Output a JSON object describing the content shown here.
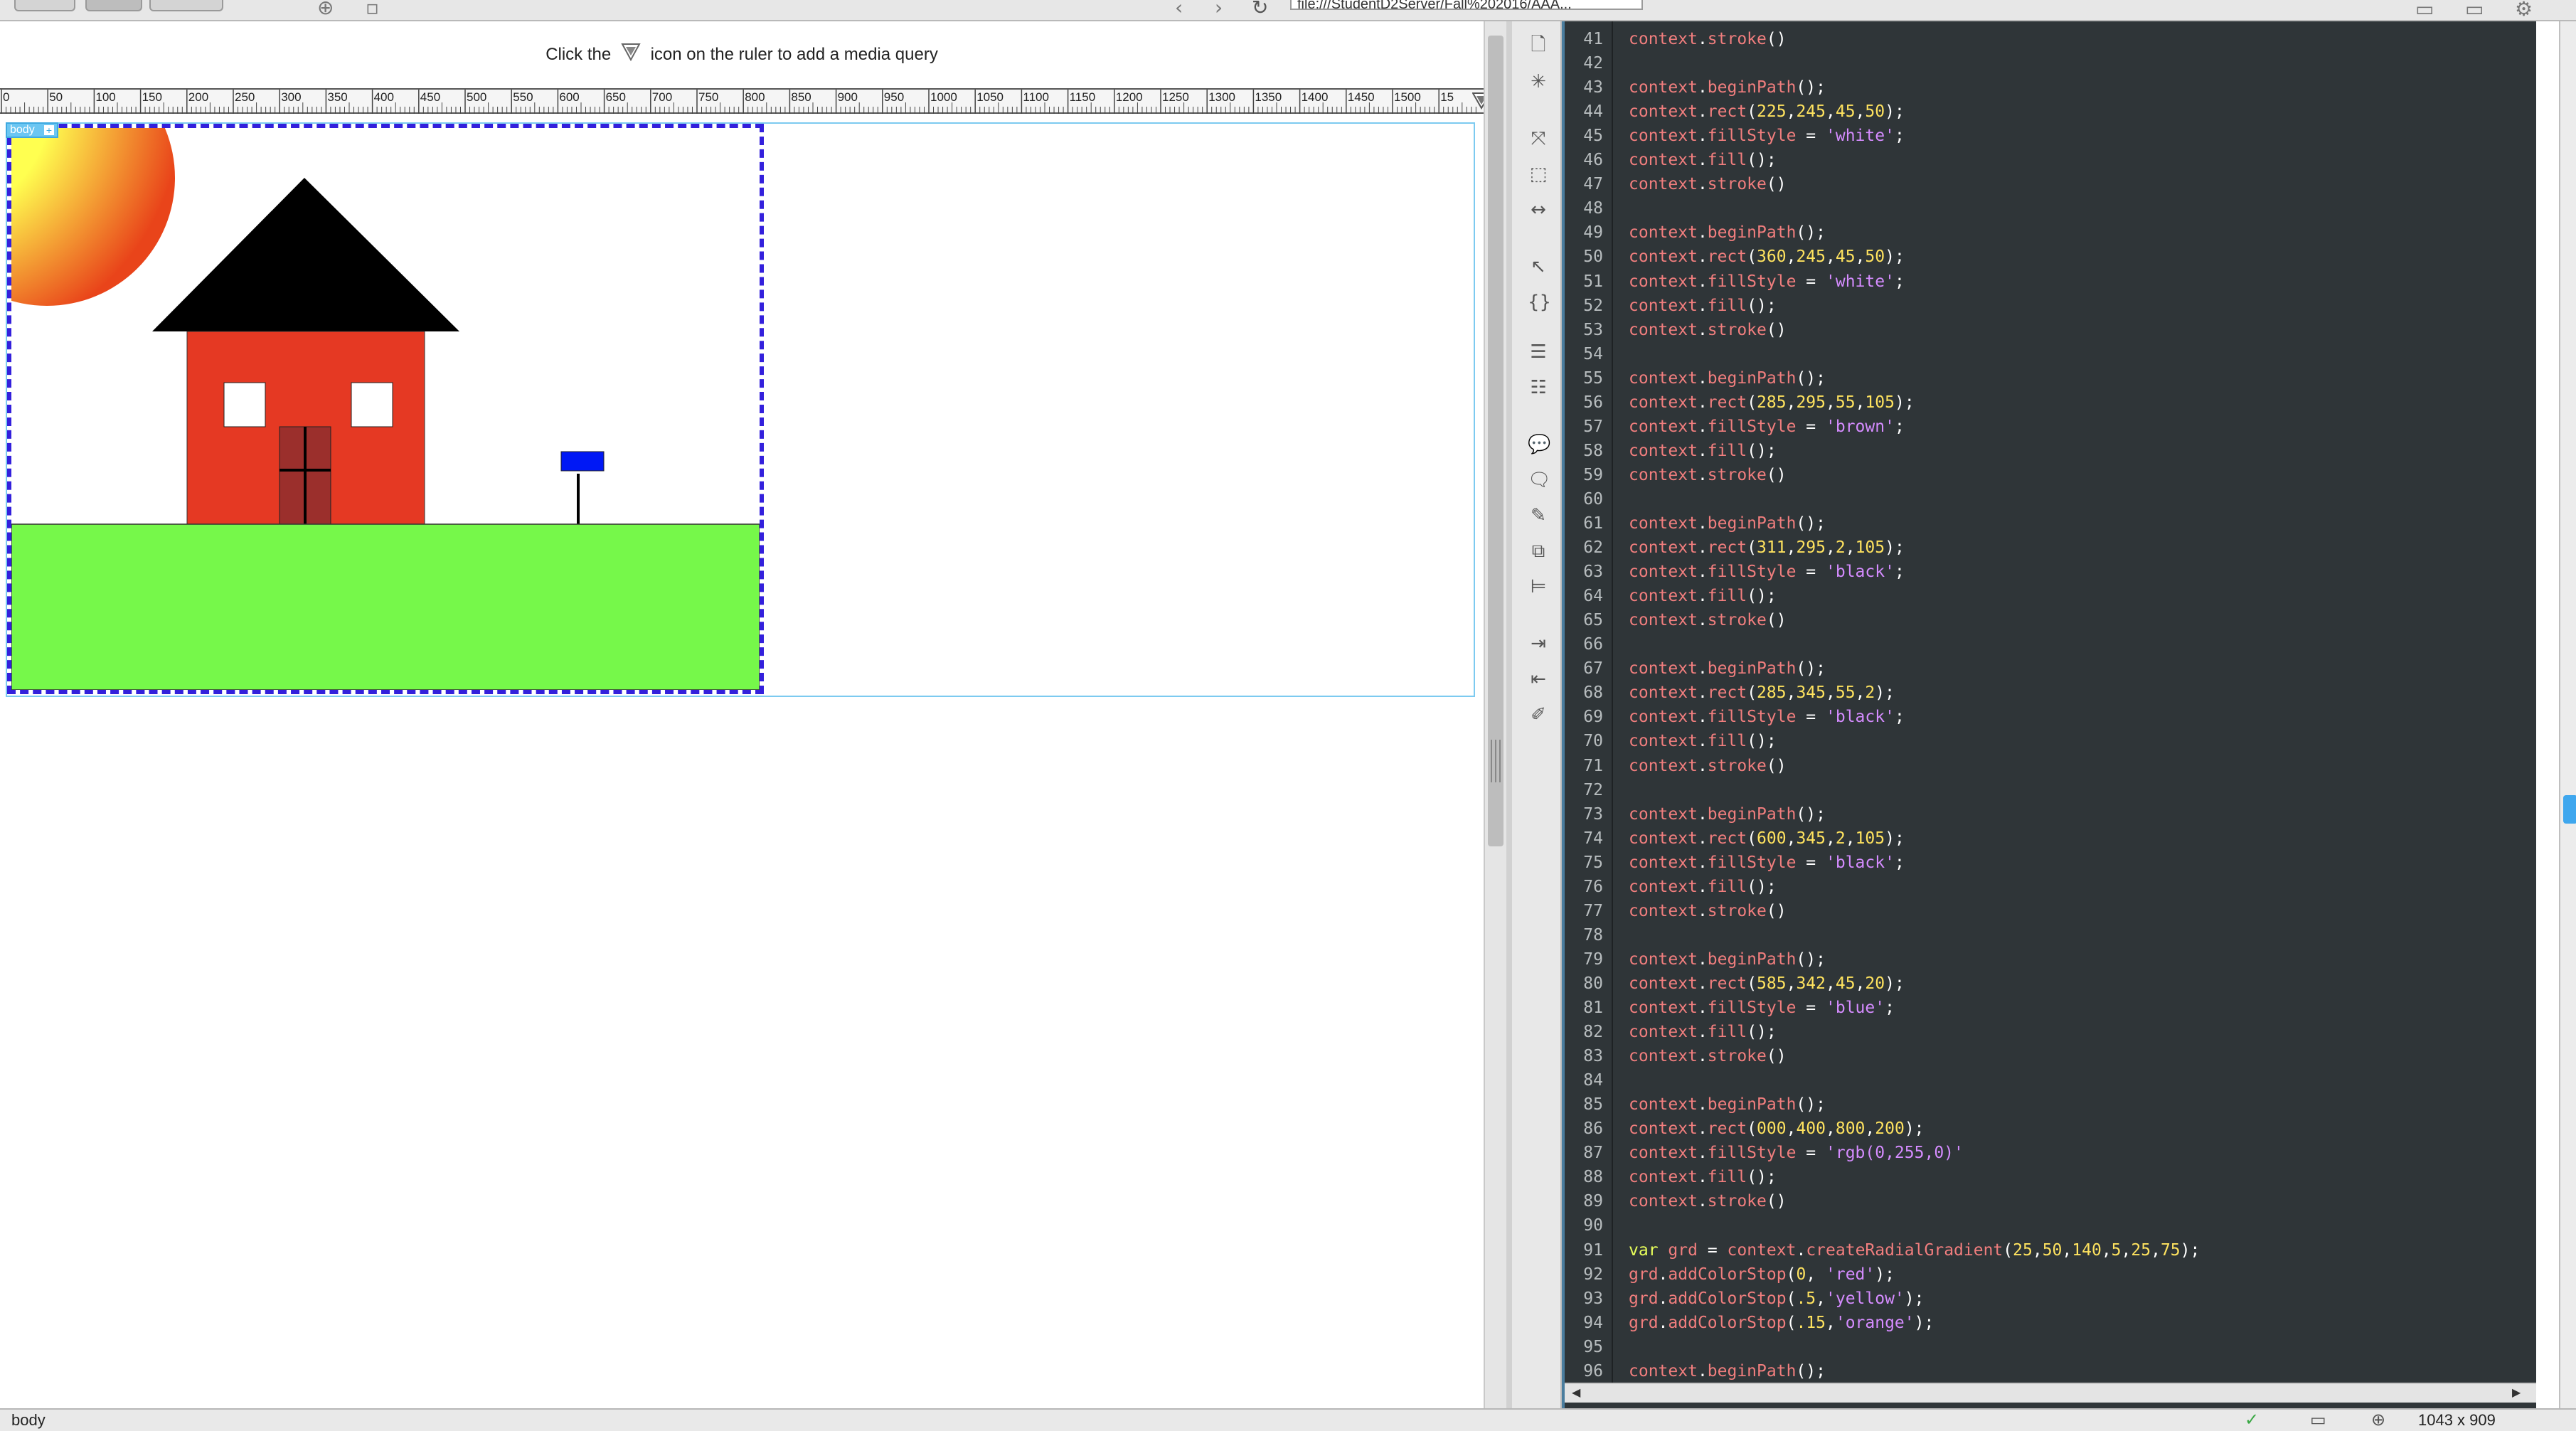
{
  "toolbar": {
    "address": "file:///StudentD2Server/Fall%202016/AAA..."
  },
  "design_view": {
    "media_query_hint_before": "Click the",
    "media_query_hint_after": "icon on the ruler to add a media query",
    "ruler_labels": [
      "0",
      "50",
      "100",
      "150",
      "200",
      "250",
      "300",
      "350",
      "400",
      "450",
      "500",
      "550",
      "600",
      "650",
      "700",
      "750",
      "800",
      "850",
      "900",
      "950",
      "1000",
      "1050",
      "1100",
      "1150",
      "1200",
      "1250",
      "1300",
      "1350",
      "1400",
      "1450",
      "1500",
      "15"
    ],
    "body_tag": "body",
    "colors": {
      "sky": "#ffffff",
      "grass": "#76f84a",
      "house": "#e53923",
      "roof": "#000000",
      "door": "#9b2f2c",
      "sign": "#0018f5",
      "sun_inner": "#ffff50",
      "sun_outer": "#e9441a",
      "selection_border": "#3320dc"
    }
  },
  "editor": {
    "lines": [
      {
        "n": "41",
        "code": "context.stroke()"
      },
      {
        "n": "42",
        "code": ""
      },
      {
        "n": "43",
        "code": "context.beginPath();"
      },
      {
        "n": "44",
        "code": "context.rect(225,245,45,50);"
      },
      {
        "n": "45",
        "code": "context.fillStyle = 'white';"
      },
      {
        "n": "46",
        "code": "context.fill();"
      },
      {
        "n": "47",
        "code": "context.stroke()"
      },
      {
        "n": "48",
        "code": ""
      },
      {
        "n": "49",
        "code": "context.beginPath();"
      },
      {
        "n": "50",
        "code": "context.rect(360,245,45,50);"
      },
      {
        "n": "51",
        "code": "context.fillStyle = 'white';"
      },
      {
        "n": "52",
        "code": "context.fill();"
      },
      {
        "n": "53",
        "code": "context.stroke()"
      },
      {
        "n": "54",
        "code": ""
      },
      {
        "n": "55",
        "code": "context.beginPath();"
      },
      {
        "n": "56",
        "code": "context.rect(285,295,55,105);"
      },
      {
        "n": "57",
        "code": "context.fillStyle = 'brown';"
      },
      {
        "n": "58",
        "code": "context.fill();"
      },
      {
        "n": "59",
        "code": "context.stroke()"
      },
      {
        "n": "60",
        "code": ""
      },
      {
        "n": "61",
        "code": "context.beginPath();"
      },
      {
        "n": "62",
        "code": "context.rect(311,295,2,105);"
      },
      {
        "n": "63",
        "code": "context.fillStyle = 'black';"
      },
      {
        "n": "64",
        "code": "context.fill();"
      },
      {
        "n": "65",
        "code": "context.stroke()"
      },
      {
        "n": "66",
        "code": ""
      },
      {
        "n": "67",
        "code": "context.beginPath();"
      },
      {
        "n": "68",
        "code": "context.rect(285,345,55,2);"
      },
      {
        "n": "69",
        "code": "context.fillStyle = 'black';"
      },
      {
        "n": "70",
        "code": "context.fill();"
      },
      {
        "n": "71",
        "code": "context.stroke()"
      },
      {
        "n": "72",
        "code": ""
      },
      {
        "n": "73",
        "code": "context.beginPath();"
      },
      {
        "n": "74",
        "code": "context.rect(600,345,2,105);"
      },
      {
        "n": "75",
        "code": "context.fillStyle = 'black';"
      },
      {
        "n": "76",
        "code": "context.fill();"
      },
      {
        "n": "77",
        "code": "context.stroke()"
      },
      {
        "n": "78",
        "code": ""
      },
      {
        "n": "79",
        "code": "context.beginPath();"
      },
      {
        "n": "80",
        "code": "context.rect(585,342,45,20);"
      },
      {
        "n": "81",
        "code": "context.fillStyle = 'blue';"
      },
      {
        "n": "82",
        "code": "context.fill();"
      },
      {
        "n": "83",
        "code": "context.stroke()"
      },
      {
        "n": "84",
        "code": ""
      },
      {
        "n": "85",
        "code": "context.beginPath();"
      },
      {
        "n": "86",
        "code": "context.rect(000,400,800,200);"
      },
      {
        "n": "87",
        "code": "context.fillStyle = 'rgb(0,255,0)'"
      },
      {
        "n": "88",
        "code": "context.fill();"
      },
      {
        "n": "89",
        "code": "context.stroke()"
      },
      {
        "n": "90",
        "code": ""
      },
      {
        "n": "91",
        "code": "var grd = context.createRadialGradient(25,50,140,5,25,75);"
      },
      {
        "n": "92",
        "code": "grd.addColorStop(0, 'red');"
      },
      {
        "n": "93",
        "code": "grd.addColorStop(.5,'yellow');"
      },
      {
        "n": "94",
        "code": "grd.addColorStop(.15,'orange');"
      },
      {
        "n": "95",
        "code": ""
      },
      {
        "n": "96",
        "code": "context.beginPath();"
      }
    ]
  },
  "statusbar": {
    "tag": "body",
    "window_size": "1043 x 909"
  }
}
